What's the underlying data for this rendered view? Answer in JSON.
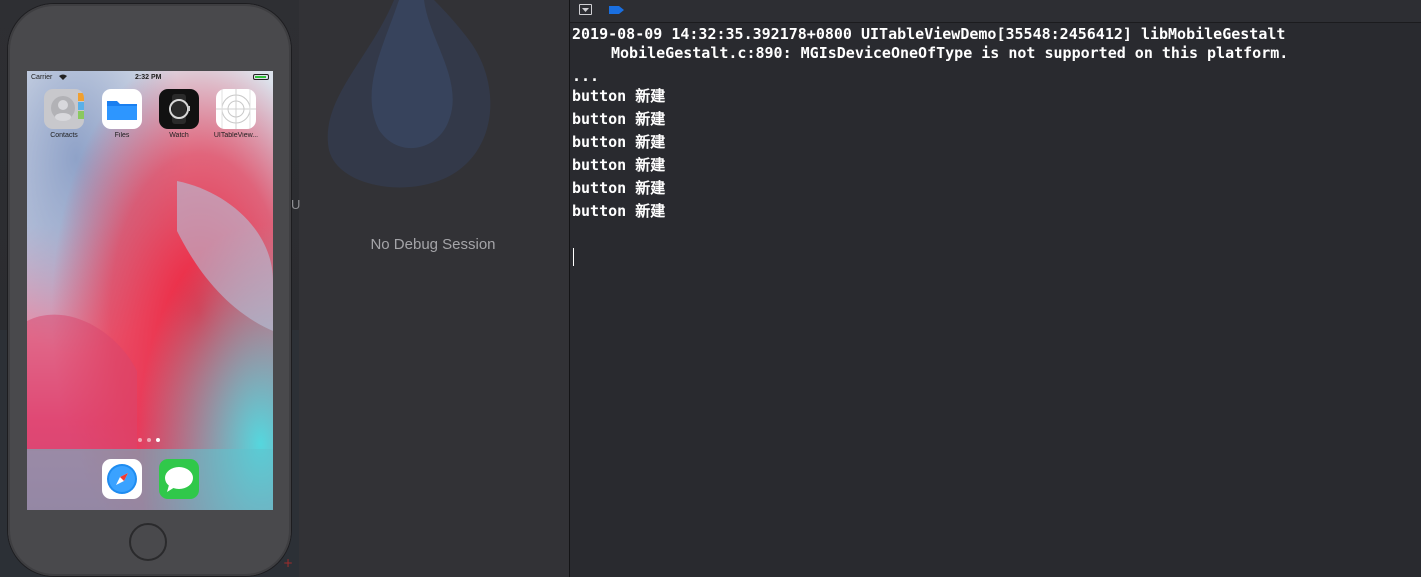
{
  "simulator": {
    "status_bar": {
      "carrier": "Carrier",
      "time": "2:32 PM"
    },
    "apps": [
      {
        "label": "Contacts",
        "icon": "contacts-icon"
      },
      {
        "label": "Files",
        "icon": "files-icon"
      },
      {
        "label": "Watch",
        "icon": "watch-icon"
      },
      {
        "label": "UITableView...",
        "icon": "uitableview-app-icon"
      }
    ],
    "dock_apps": [
      {
        "icon": "safari-icon"
      },
      {
        "icon": "messages-icon"
      }
    ],
    "page_indicator": {
      "count": 3,
      "active": 2
    }
  },
  "debug_pane": {
    "empty_message": "No Debug Session"
  },
  "console": {
    "lines": [
      "2019-08-09 14:32:35.392178+0800 UITableViewDemo[35548:2456412] libMobileGestalt",
      "MobileGestalt.c:890: MGIsDeviceOneOfType is not supported on this platform.",
      "...",
      "button 新建",
      "button 新建",
      "button 新建",
      "button 新建",
      "button 新建",
      "button 新建"
    ]
  },
  "sidebar_fragment": "U",
  "corner_glyph": "+",
  "colors": {
    "accent": "#1a6fe0",
    "console_bg": "#292a2f",
    "debug_bg": "#323236"
  }
}
